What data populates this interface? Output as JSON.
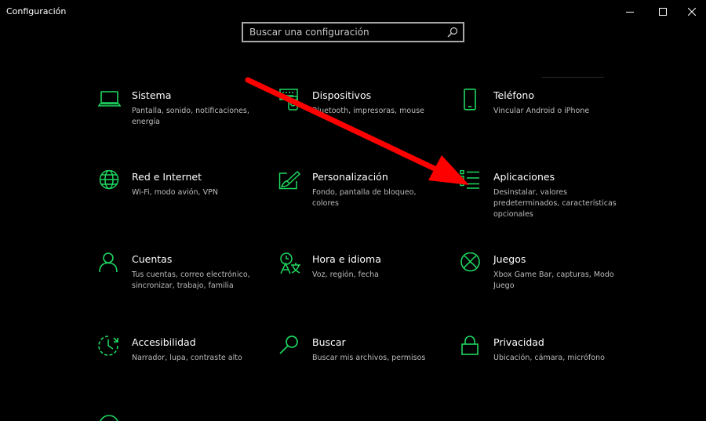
{
  "window": {
    "title": "Configuración"
  },
  "search": {
    "placeholder": "Buscar una configuración"
  },
  "accent_color": "#1ed760",
  "annotation_color": "#ff0000",
  "tiles": [
    {
      "label": "Sistema",
      "desc": "Pantalla, sonido, notificaciones, energía",
      "icon": "laptop-icon"
    },
    {
      "label": "Dispositivos",
      "desc": "Bluetooth, impresoras, mouse",
      "icon": "keyboard-icon"
    },
    {
      "label": "Teléfono",
      "desc": "Vincular Android o iPhone",
      "icon": "phone-icon"
    },
    {
      "label": "Red e Internet",
      "desc": "Wi-Fi, modo avión, VPN",
      "icon": "globe-icon"
    },
    {
      "label": "Personalización",
      "desc": "Fondo, pantalla de bloqueo, colores",
      "icon": "paint-icon"
    },
    {
      "label": "Aplicaciones",
      "desc": "Desinstalar, valores predeterminados, características opcionales",
      "icon": "app-list-icon"
    },
    {
      "label": "Cuentas",
      "desc": "Tus cuentas, correo electrónico, sincronizar, trabajo, familia",
      "icon": "person-icon"
    },
    {
      "label": "Hora e idioma",
      "desc": "Voz, región, fecha",
      "icon": "time-language-icon"
    },
    {
      "label": "Juegos",
      "desc": "Xbox Game Bar, capturas, Modo Juego",
      "icon": "xbox-icon"
    },
    {
      "label": "Accesibilidad",
      "desc": "Narrador, lupa, contraste alto",
      "icon": "accessibility-icon"
    },
    {
      "label": "Buscar",
      "desc": "Buscar mis archivos, permisos",
      "icon": "magnifier-icon"
    },
    {
      "label": "Privacidad",
      "desc": "Ubicación, cámara, micrófono",
      "icon": "lock-icon"
    }
  ]
}
